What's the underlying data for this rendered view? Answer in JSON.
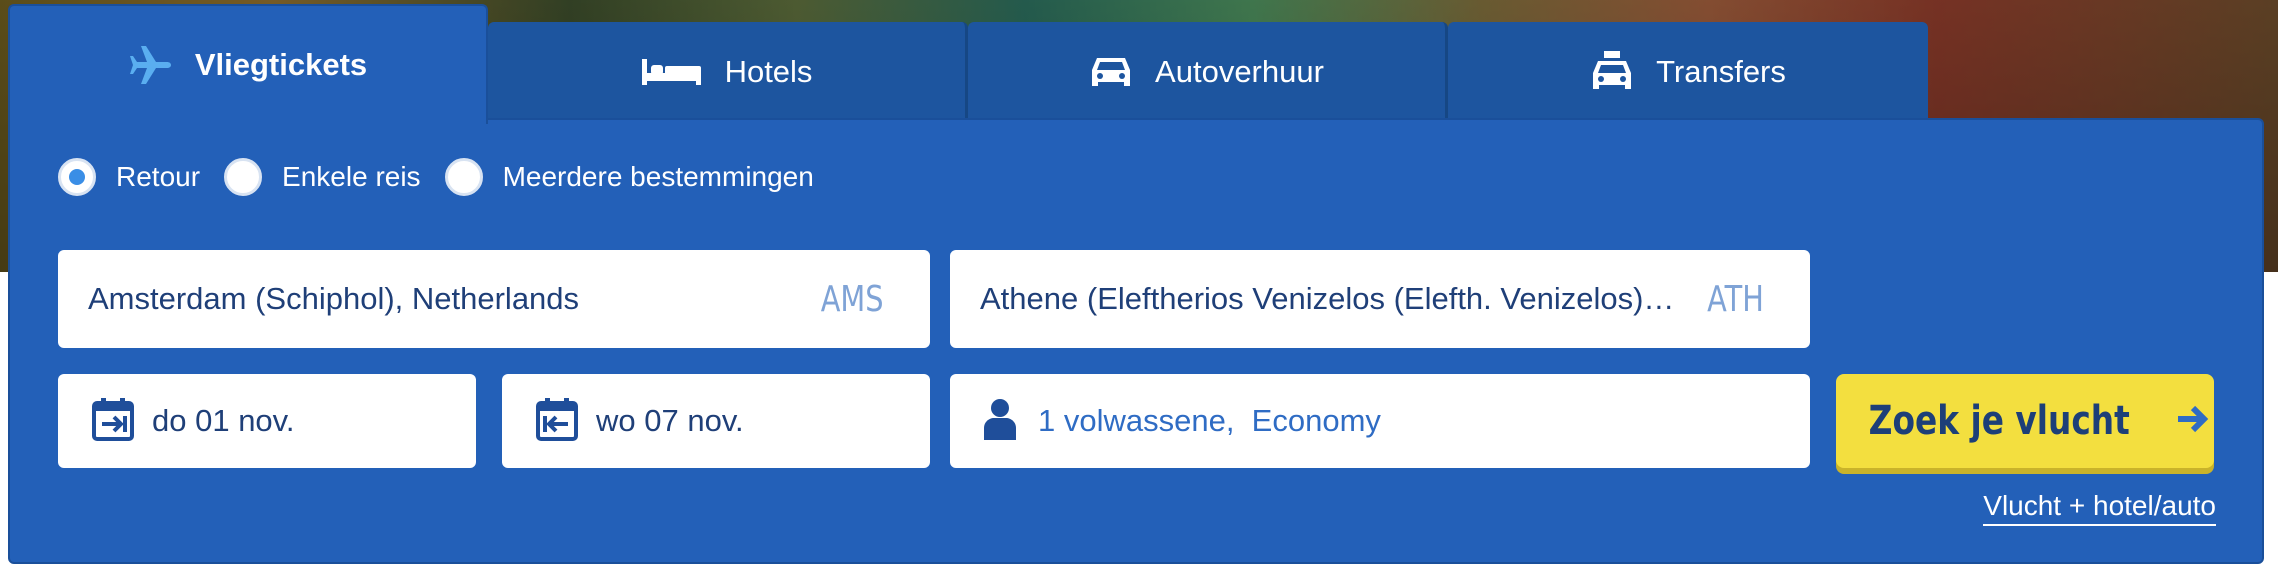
{
  "tabs": [
    {
      "label": "Vliegtickets",
      "icon": "airplane-icon",
      "active": true
    },
    {
      "label": "Hotels",
      "icon": "bed-icon",
      "active": false
    },
    {
      "label": "Autoverhuur",
      "icon": "car-icon",
      "active": false
    },
    {
      "label": "Transfers",
      "icon": "taxi-icon",
      "active": false
    }
  ],
  "trip_type": {
    "options": [
      {
        "label": "Retour",
        "selected": true
      },
      {
        "label": "Enkele reis",
        "selected": false
      },
      {
        "label": "Meerdere bestemmingen",
        "selected": false
      }
    ]
  },
  "origin": {
    "value": "Amsterdam (Schiphol), Netherlands",
    "code": "AMS"
  },
  "destination": {
    "value": "Athene (Eleftherios Venizelos (Elefth. Venizelos)…",
    "code": "ATH"
  },
  "depart_date": {
    "value": "do 01 nov.",
    "icon": "calendar-depart-icon"
  },
  "return_date": {
    "value": "wo 07 nov.",
    "icon": "calendar-return-icon"
  },
  "passengers": {
    "value": "1 volwassene,  Economy",
    "icon": "person-icon"
  },
  "search_button": {
    "label": "Zoek je vlucht",
    "icon": "arrow-right-icon"
  },
  "combo_link": {
    "label": "Vlucht + hotel/auto"
  },
  "colors": {
    "panel": "#2360b8",
    "tab_inactive": "#1d559f",
    "button": "#f3df3f",
    "field_text": "#1f3f78",
    "code_text": "#7fa3d6",
    "radio_accent": "#3a8ee6",
    "plane_icon": "#5aaef0"
  }
}
